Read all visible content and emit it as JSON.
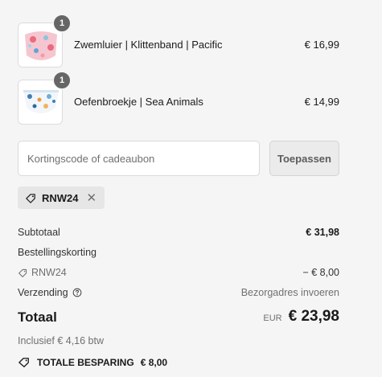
{
  "items": [
    {
      "name": "Zwemluier | Klittenband | Pacific",
      "price": "€ 16,99",
      "quantity": "1"
    },
    {
      "name": "Oefenbroekje | Sea Animals",
      "price": "€ 14,99",
      "quantity": "1"
    }
  ],
  "discount": {
    "placeholder": "Kortingscode of cadeaubon",
    "apply_label": "Toepassen",
    "applied_code": "RNW24"
  },
  "summary": {
    "subtotal_label": "Subtotaal",
    "subtotal_value": "€ 31,98",
    "order_discount_label": "Bestellingskorting",
    "discount_code": "RNW24",
    "discount_value": "− € 8,00",
    "shipping_label": "Verzending",
    "shipping_value": "Bezorgadres invoeren",
    "total_label": "Totaal",
    "currency": "EUR",
    "total_value": "€ 23,98",
    "tax_note": "Inclusief € 4,16 btw",
    "savings_label": "TOTALE BESPARING",
    "savings_value": "€ 8,00"
  },
  "icons": {
    "tag": "tag-icon",
    "close": "close-icon",
    "help": "help-circle-icon",
    "savings": "tag-icon"
  },
  "colors": {
    "background": "#f5f5f5",
    "badge": "#666666",
    "text": "#1a1a1a",
    "muted": "#707070"
  }
}
